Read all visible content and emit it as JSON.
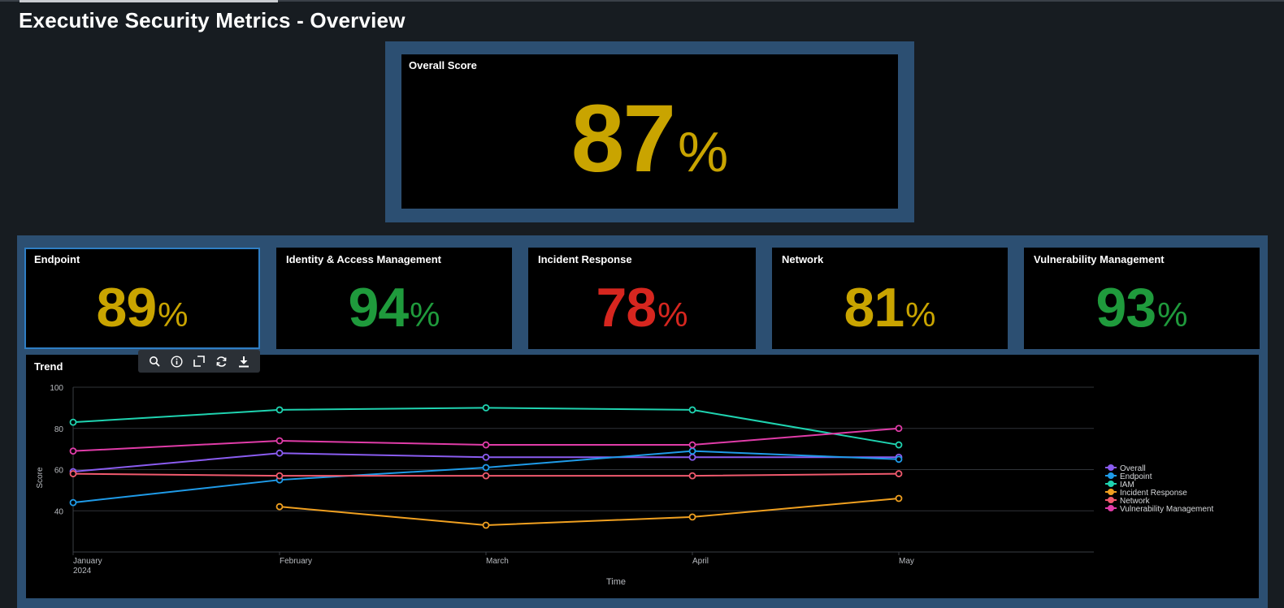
{
  "page": {
    "title": "Executive Security Metrics - Overview"
  },
  "overall": {
    "label": "Overall Score",
    "value": "87",
    "unit": "%",
    "color": "#c9a400"
  },
  "kpis": [
    {
      "label": "Endpoint",
      "value": "89",
      "unit": "%",
      "color": "#c9a400"
    },
    {
      "label": "Identity & Access Management",
      "value": "94",
      "unit": "%",
      "color": "#1f9a3c"
    },
    {
      "label": "Incident Response",
      "value": "78",
      "unit": "%",
      "color": "#d6261f"
    },
    {
      "label": "Network",
      "value": "81",
      "unit": "%",
      "color": "#c9a400"
    },
    {
      "label": "Vulnerability Management",
      "value": "93",
      "unit": "%",
      "color": "#1f9a3c"
    }
  ],
  "trend": {
    "label": "Trend"
  },
  "toolbar": {
    "icons": [
      "search-icon",
      "info-icon",
      "expand-icon",
      "refresh-icon",
      "download-icon"
    ]
  },
  "chart_data": {
    "type": "line",
    "xlabel": "Time",
    "ylabel": "Score",
    "x": [
      "January",
      "February",
      "March",
      "April",
      "May"
    ],
    "x_sublabel_first": "2024",
    "yticks": [
      40,
      60,
      80,
      100
    ],
    "ylim": [
      20,
      100
    ],
    "grid": true,
    "legend_position": "right",
    "series": [
      {
        "name": "Overall",
        "color": "#8a5cf0",
        "values": [
          59,
          68,
          66,
          66,
          66
        ]
      },
      {
        "name": "Endpoint",
        "color": "#1f9be8",
        "values": [
          44,
          55,
          61,
          69,
          65
        ]
      },
      {
        "name": "IAM",
        "color": "#1fd3b0",
        "values": [
          83,
          89,
          90,
          89,
          72
        ]
      },
      {
        "name": "Incident Response",
        "color": "#f0a020",
        "values": [
          null,
          42,
          33,
          37,
          46
        ]
      },
      {
        "name": "Network",
        "color": "#f05a6e",
        "values": [
          58,
          57,
          57,
          57,
          58
        ]
      },
      {
        "name": "Vulnerability Management",
        "color": "#e03ca8",
        "values": [
          69,
          74,
          72,
          72,
          80
        ]
      }
    ]
  }
}
